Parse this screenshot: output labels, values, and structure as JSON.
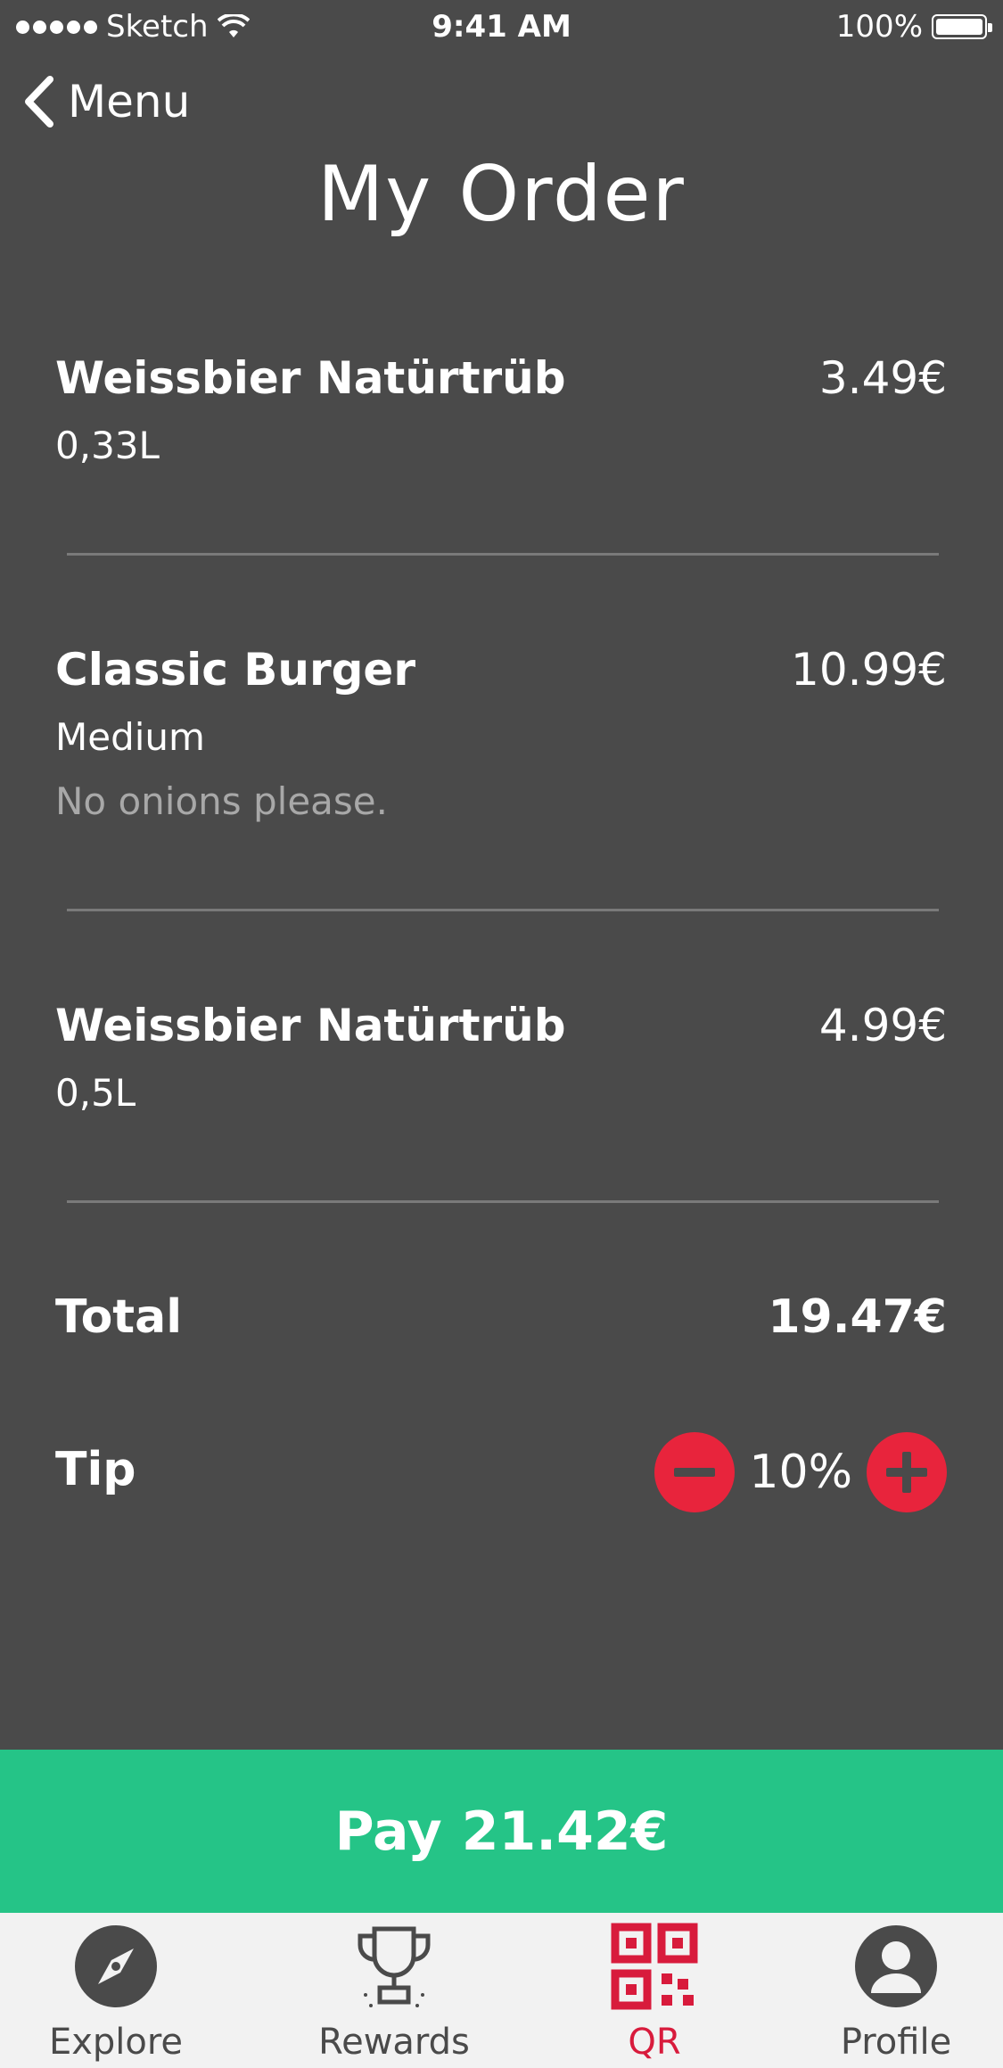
{
  "status_bar": {
    "carrier": "Sketch",
    "time": "9:41 AM",
    "battery": "100%"
  },
  "nav": {
    "back_label": "Menu",
    "title": "My Order"
  },
  "order": {
    "items": [
      {
        "name": "Weissbier Natürtrüb",
        "size": "0,33L",
        "price": "3.49€"
      },
      {
        "name": "Classic Burger",
        "size": "Medium",
        "note": "No onions please.",
        "price": "10.99€"
      },
      {
        "name": "Weissbier Natürtrüb",
        "size": "0,5L",
        "price": "4.99€"
      }
    ],
    "total_label": "Total",
    "total_value": "19.47€",
    "tip_label": "Tip",
    "tip_value": "10%"
  },
  "pay": {
    "label": "Pay",
    "amount": "21.42€"
  },
  "tabbar": {
    "tabs": [
      {
        "label": "Explore",
        "icon": "compass-icon"
      },
      {
        "label": "Rewards",
        "icon": "trophy-icon"
      },
      {
        "label": "QR",
        "icon": "qr-code-icon",
        "active": true
      },
      {
        "label": "Profile",
        "icon": "profile-icon"
      }
    ]
  },
  "colors": {
    "background": "#4a4a4a",
    "accent_red": "#e8243c",
    "pay_green": "#25c487",
    "tab_active": "#d81b3c",
    "tabbar_bg": "#f2f2f2"
  }
}
